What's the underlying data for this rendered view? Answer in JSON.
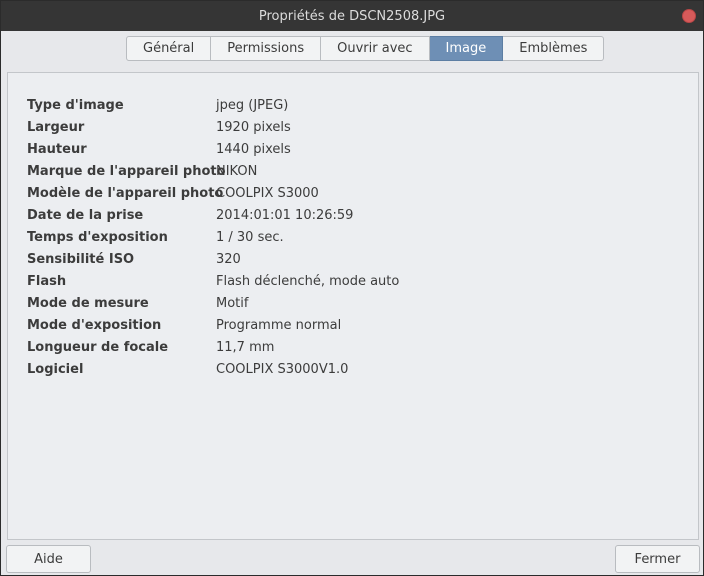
{
  "window": {
    "title": "Propriétés de DSCN2508.JPG"
  },
  "tabs": [
    {
      "label": "Général",
      "active": false
    },
    {
      "label": "Permissions",
      "active": false
    },
    {
      "label": "Ouvrir avec",
      "active": false
    },
    {
      "label": "Image",
      "active": true
    },
    {
      "label": "Emblèmes",
      "active": false
    }
  ],
  "properties": [
    {
      "key": "Type d'image",
      "value": "jpeg (JPEG)"
    },
    {
      "key": "Largeur",
      "value": "1920 pixels"
    },
    {
      "key": "Hauteur",
      "value": "1440 pixels"
    },
    {
      "key": "Marque de l'appareil photo",
      "value": "NIKON"
    },
    {
      "key": "Modèle de l'appareil photo",
      "value": "COOLPIX S3000"
    },
    {
      "key": "Date de la prise",
      "value": "2014:01:01 10:26:59"
    },
    {
      "key": "Temps d'exposition",
      "value": "1 / 30 sec."
    },
    {
      "key": "Sensibilité ISO",
      "value": "320"
    },
    {
      "key": "Flash",
      "value": "Flash déclenché, mode auto"
    },
    {
      "key": "Mode de mesure",
      "value": "Motif"
    },
    {
      "key": "Mode d'exposition",
      "value": "Programme normal"
    },
    {
      "key": "Longueur de focale",
      "value": "11,7 mm"
    },
    {
      "key": "Logiciel",
      "value": "COOLPIX S3000V1.0"
    }
  ],
  "buttons": {
    "help": "Aide",
    "close": "Fermer"
  },
  "colors": {
    "titlebar": "#353535",
    "active_tab": "#6e8fb5",
    "close_dot": "#d65a5a"
  }
}
